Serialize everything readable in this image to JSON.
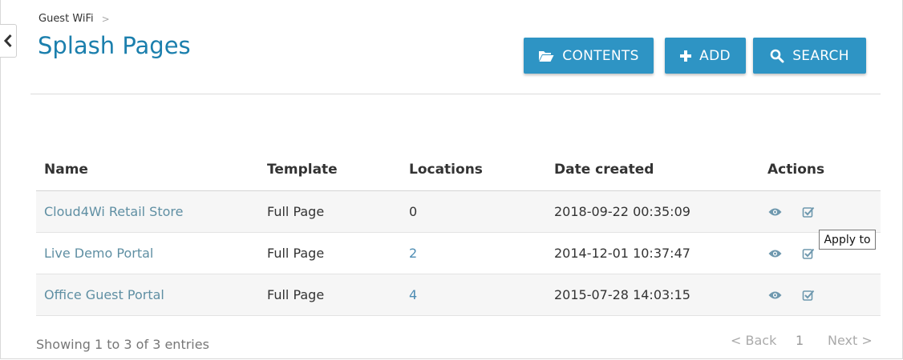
{
  "breadcrumb": {
    "parent": "Guest WiFi",
    "separator": ">"
  },
  "page": {
    "title": "Splash Pages"
  },
  "toolbar": {
    "contents_label": "CONTENTS",
    "add_label": "ADD",
    "search_label": "SEARCH",
    "button_color": "#2e94c4"
  },
  "table": {
    "headers": {
      "name": "Name",
      "template": "Template",
      "locations": "Locations",
      "date_created": "Date created",
      "actions": "Actions"
    },
    "rows": [
      {
        "name": "Cloud4Wi Retail Store",
        "template": "Full Page",
        "locations": "0",
        "date_created": "2018-09-22 00:35:09"
      },
      {
        "name": "Live Demo Portal",
        "template": "Full Page",
        "locations": "2",
        "date_created": "2014-12-01 10:37:47"
      },
      {
        "name": "Office Guest Portal",
        "template": "Full Page",
        "locations": "4",
        "date_created": "2015-07-28 14:03:15"
      }
    ]
  },
  "tooltip": {
    "text": "Apply to"
  },
  "footer": {
    "entries": "Showing 1 to 3 of 3 entries"
  },
  "pagination": {
    "back": "< Back",
    "page": "1",
    "next": "Next >"
  },
  "colors": {
    "title": "#1b7fad",
    "link": "#5f8fa3"
  }
}
